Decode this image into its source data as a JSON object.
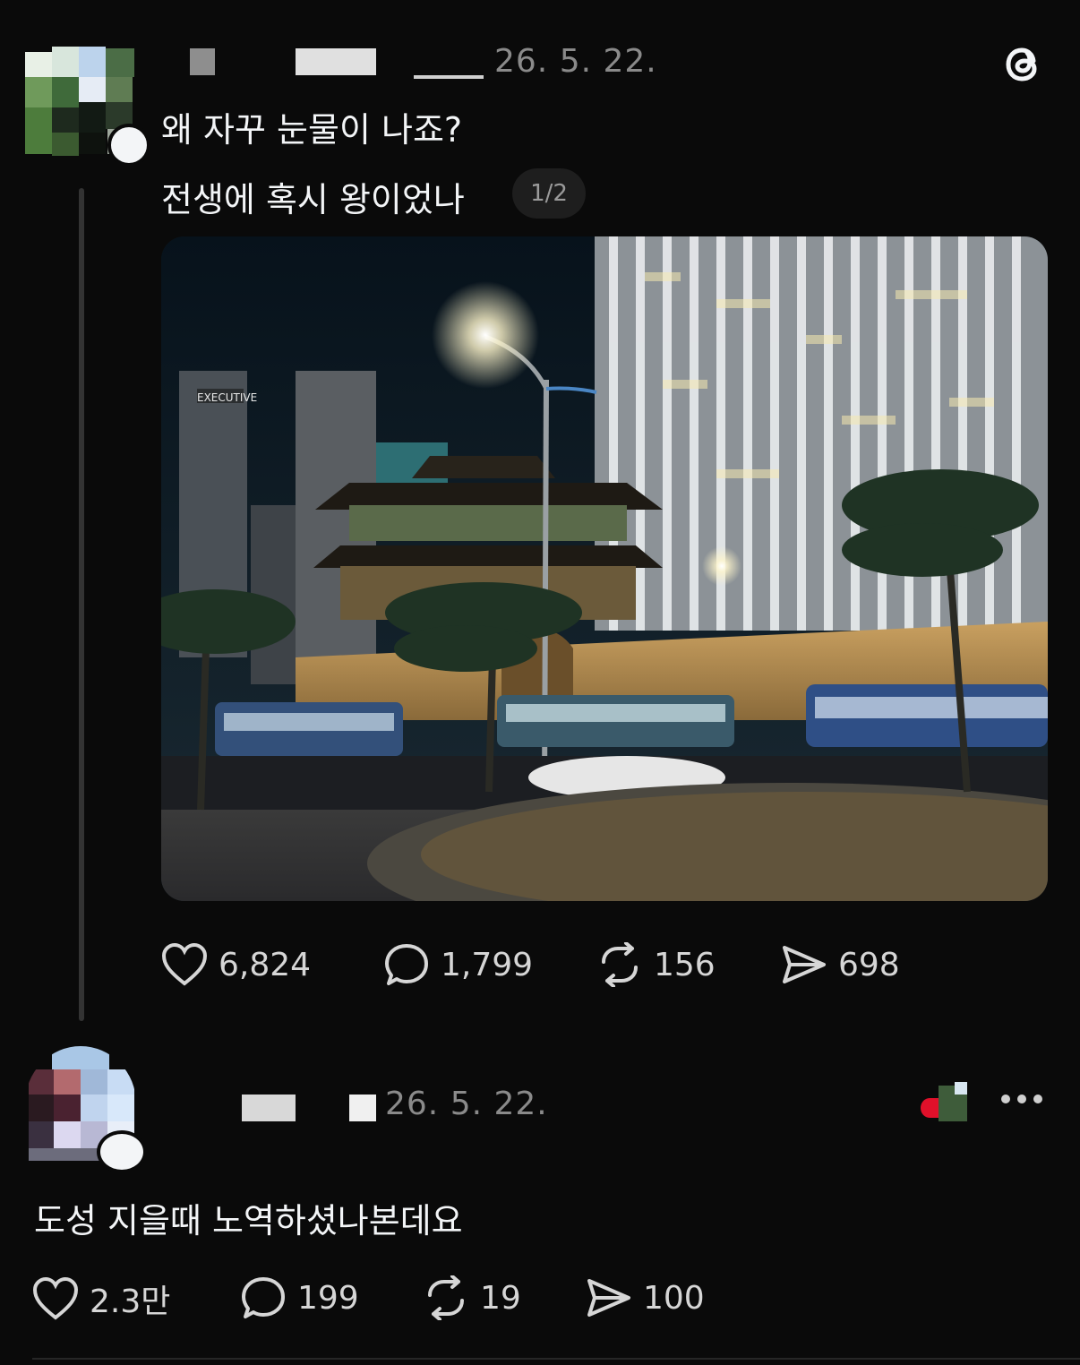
{
  "post": {
    "date": "26. 5. 22.",
    "line1": "왜 자꾸 눈물이 나죠?",
    "line2": "전생에 혹시 왕이었나",
    "page_indicator": "1/2",
    "photo_sign": "EXECUTIVE",
    "stats": {
      "likes": "6,824",
      "comments": "1,799",
      "reposts": "156",
      "shares": "698"
    }
  },
  "reply": {
    "date": "26. 5. 22.",
    "text": "도성 지을때 노역하셨나본데요",
    "stats": {
      "likes": "2.3만",
      "comments": "199",
      "reposts": "19",
      "shares": "100"
    }
  },
  "icons": {
    "app": "threads-logo-icon",
    "like": "heart-icon",
    "comment": "speech-bubble-icon",
    "repost": "repost-icon",
    "share": "paper-plane-icon",
    "more": "more-horizontal-icon"
  },
  "colors": {
    "background": "#0a0a0a",
    "text": "#f3f5f7",
    "muted": "#8a8a8a"
  }
}
